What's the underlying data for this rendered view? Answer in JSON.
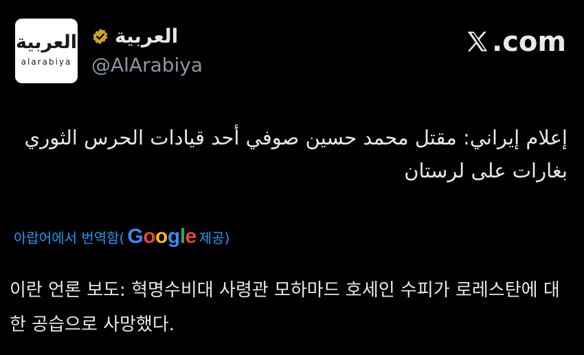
{
  "account": {
    "logo_ar": "العربية",
    "logo_latin": "alarabiya",
    "display_name": "العربية",
    "handle": "@AlArabiya",
    "verified_color": "#c9a227"
  },
  "site": {
    "label": ".com"
  },
  "tweet": {
    "arabic_text": "إعلام إيراني: مقتل محمد حسين صوفي أحد قيادات الحرس الثوري بغارات على لرستان",
    "translation_prefix": "아랍어에서 번역함(",
    "translation_google": [
      "G",
      "o",
      "o",
      "g",
      "l",
      "e"
    ],
    "translation_suffix": " 제공)",
    "translated_text": "이란 언론 보도: 혁명수비대 사령관 모하마드 호세인 수피가 로레스탄에 대한 공습으로 사망했다."
  },
  "icons": {
    "badge": "verified-badge-icon",
    "x_logo": "x-logo-icon"
  }
}
